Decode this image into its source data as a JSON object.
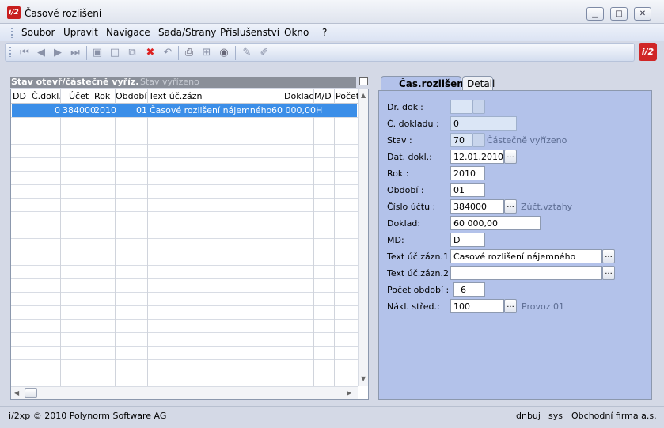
{
  "window": {
    "title": "Časové rozlišení",
    "logo": "i/2",
    "brand_logo": "i/2"
  },
  "menu": [
    "Soubor",
    "Upravit",
    "Navigace",
    "Sada/Strany",
    "Příslušenství",
    "Okno",
    "?"
  ],
  "toolbar_icons": [
    "first-record-icon",
    "prev-record-icon",
    "next-record-icon",
    "last-record-icon",
    "save-icon",
    "new-document-icon",
    "copy-icon",
    "delete-icon",
    "undo-icon",
    "print-icon",
    "tree-icon",
    "refresh-icon",
    "edit-icon",
    "clear-edit-icon"
  ],
  "left_panel": {
    "tab_active": "Stav otevř/částečně vyříz.",
    "tab_inactive": "Stav vyřízeno",
    "columns": [
      "DD",
      "Č.dokl.",
      "Účet",
      "Rok",
      "Období",
      "Text úč.zázn",
      "Doklad",
      "M/D",
      "Počet"
    ],
    "rows": [
      {
        "dd": "",
        "cdokl": "0",
        "ucet": "384000",
        "rok": "2010",
        "obdobi": "01",
        "text": "Časové rozlišení nájemného",
        "doklad": "60 000,00",
        "md": "H",
        "pocet": ""
      }
    ]
  },
  "right_panel": {
    "tabs": [
      "Čas.rozlišení",
      "Detail"
    ],
    "fields": {
      "dr_dokl": {
        "label": "Dr. dokl:",
        "value": ""
      },
      "c_dokladu": {
        "label": "Č. dokladu :",
        "value": "0"
      },
      "stav": {
        "label": "Stav :",
        "value": "70",
        "hint": "Částečně vyřízeno"
      },
      "dat_dokl": {
        "label": "Dat. dokl.:",
        "value": "12.01.2010"
      },
      "rok": {
        "label": "Rok :",
        "value": "2010"
      },
      "obdobi": {
        "label": "Období :",
        "value": "01"
      },
      "cislo_uctu": {
        "label": "Číslo účtu :",
        "value": "384000",
        "hint": "Zúčt.vztahy"
      },
      "doklad": {
        "label": "Doklad:",
        "value": "60 000,00"
      },
      "md": {
        "label": "MD:",
        "value": "D"
      },
      "text1": {
        "label": "Text úč.zázn.1:",
        "value": "Časové rozlišení nájemného"
      },
      "text2": {
        "label": "Text úč.zázn.2:",
        "value": ""
      },
      "pocet_obdobi": {
        "label": "Počet období :",
        "value": "6"
      },
      "nakl_stred": {
        "label": "Nákl. střed.:",
        "value": "100",
        "hint": "Provoz 01"
      }
    },
    "dots": "..."
  },
  "status": {
    "left": "i/2xp © 2010 Polynorm Software AG",
    "user": "dnbuj",
    "sys": "sys",
    "company": "Obchodní firma a.s."
  }
}
